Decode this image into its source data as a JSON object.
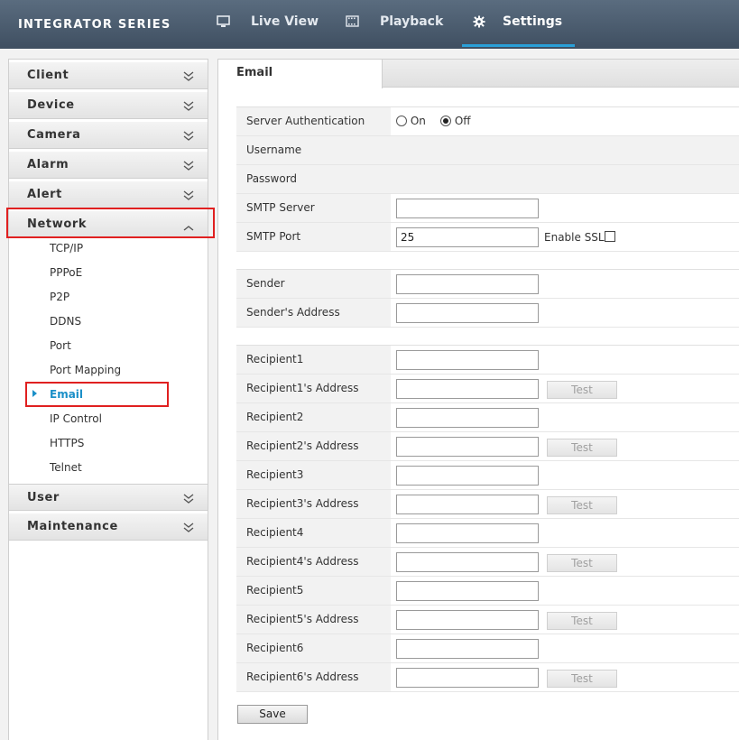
{
  "header": {
    "brand": "INTEGRATOR SERIES",
    "tabs": [
      {
        "label": "Live View",
        "icon": "monitor-icon"
      },
      {
        "label": "Playback",
        "icon": "film-icon"
      },
      {
        "label": "Settings",
        "icon": "gear-icon",
        "active": true
      }
    ],
    "accent": "#2aa0d8"
  },
  "sidebar": {
    "sections": [
      {
        "label": "Client"
      },
      {
        "label": "Device"
      },
      {
        "label": "Camera"
      },
      {
        "label": "Alarm"
      },
      {
        "label": "Alert"
      },
      {
        "label": "Network",
        "expanded": true
      },
      {
        "label": "User"
      },
      {
        "label": "Maintenance"
      }
    ],
    "network_items": [
      "TCP/IP",
      "PPPoE",
      "P2P",
      "DDNS",
      "Port",
      "Port Mapping",
      "Email",
      "IP Control",
      "HTTPS",
      "Telnet"
    ],
    "active_item": "Email",
    "highlight_color": "#e02020"
  },
  "content": {
    "tab_label": "Email",
    "server": {
      "auth_label": "Server Authentication",
      "auth_on": "On",
      "auth_off": "Off",
      "auth_selected": "Off",
      "username_label": "Username",
      "password_label": "Password",
      "smtp_server_label": "SMTP Server",
      "smtp_server_value": "",
      "smtp_port_label": "SMTP Port",
      "smtp_port_value": "25",
      "ssl_label": "Enable SSL",
      "ssl_checked": false
    },
    "sender": {
      "sender_label": "Sender",
      "sender_value": "",
      "address_label": "Sender's Address",
      "address_value": ""
    },
    "recipients": [
      {
        "label": "Recipient1",
        "address_label": "Recipient1's Address",
        "value": "",
        "address": ""
      },
      {
        "label": "Recipient2",
        "address_label": "Recipient2's Address",
        "value": "",
        "address": ""
      },
      {
        "label": "Recipient3",
        "address_label": "Recipient3's Address",
        "value": "",
        "address": ""
      },
      {
        "label": "Recipient4",
        "address_label": "Recipient4's Address",
        "value": "",
        "address": ""
      },
      {
        "label": "Recipient5",
        "address_label": "Recipient5's Address",
        "value": "",
        "address": ""
      },
      {
        "label": "Recipient6",
        "address_label": "Recipient6's Address",
        "value": "",
        "address": ""
      }
    ],
    "test_label": "Test",
    "save_label": "Save"
  }
}
